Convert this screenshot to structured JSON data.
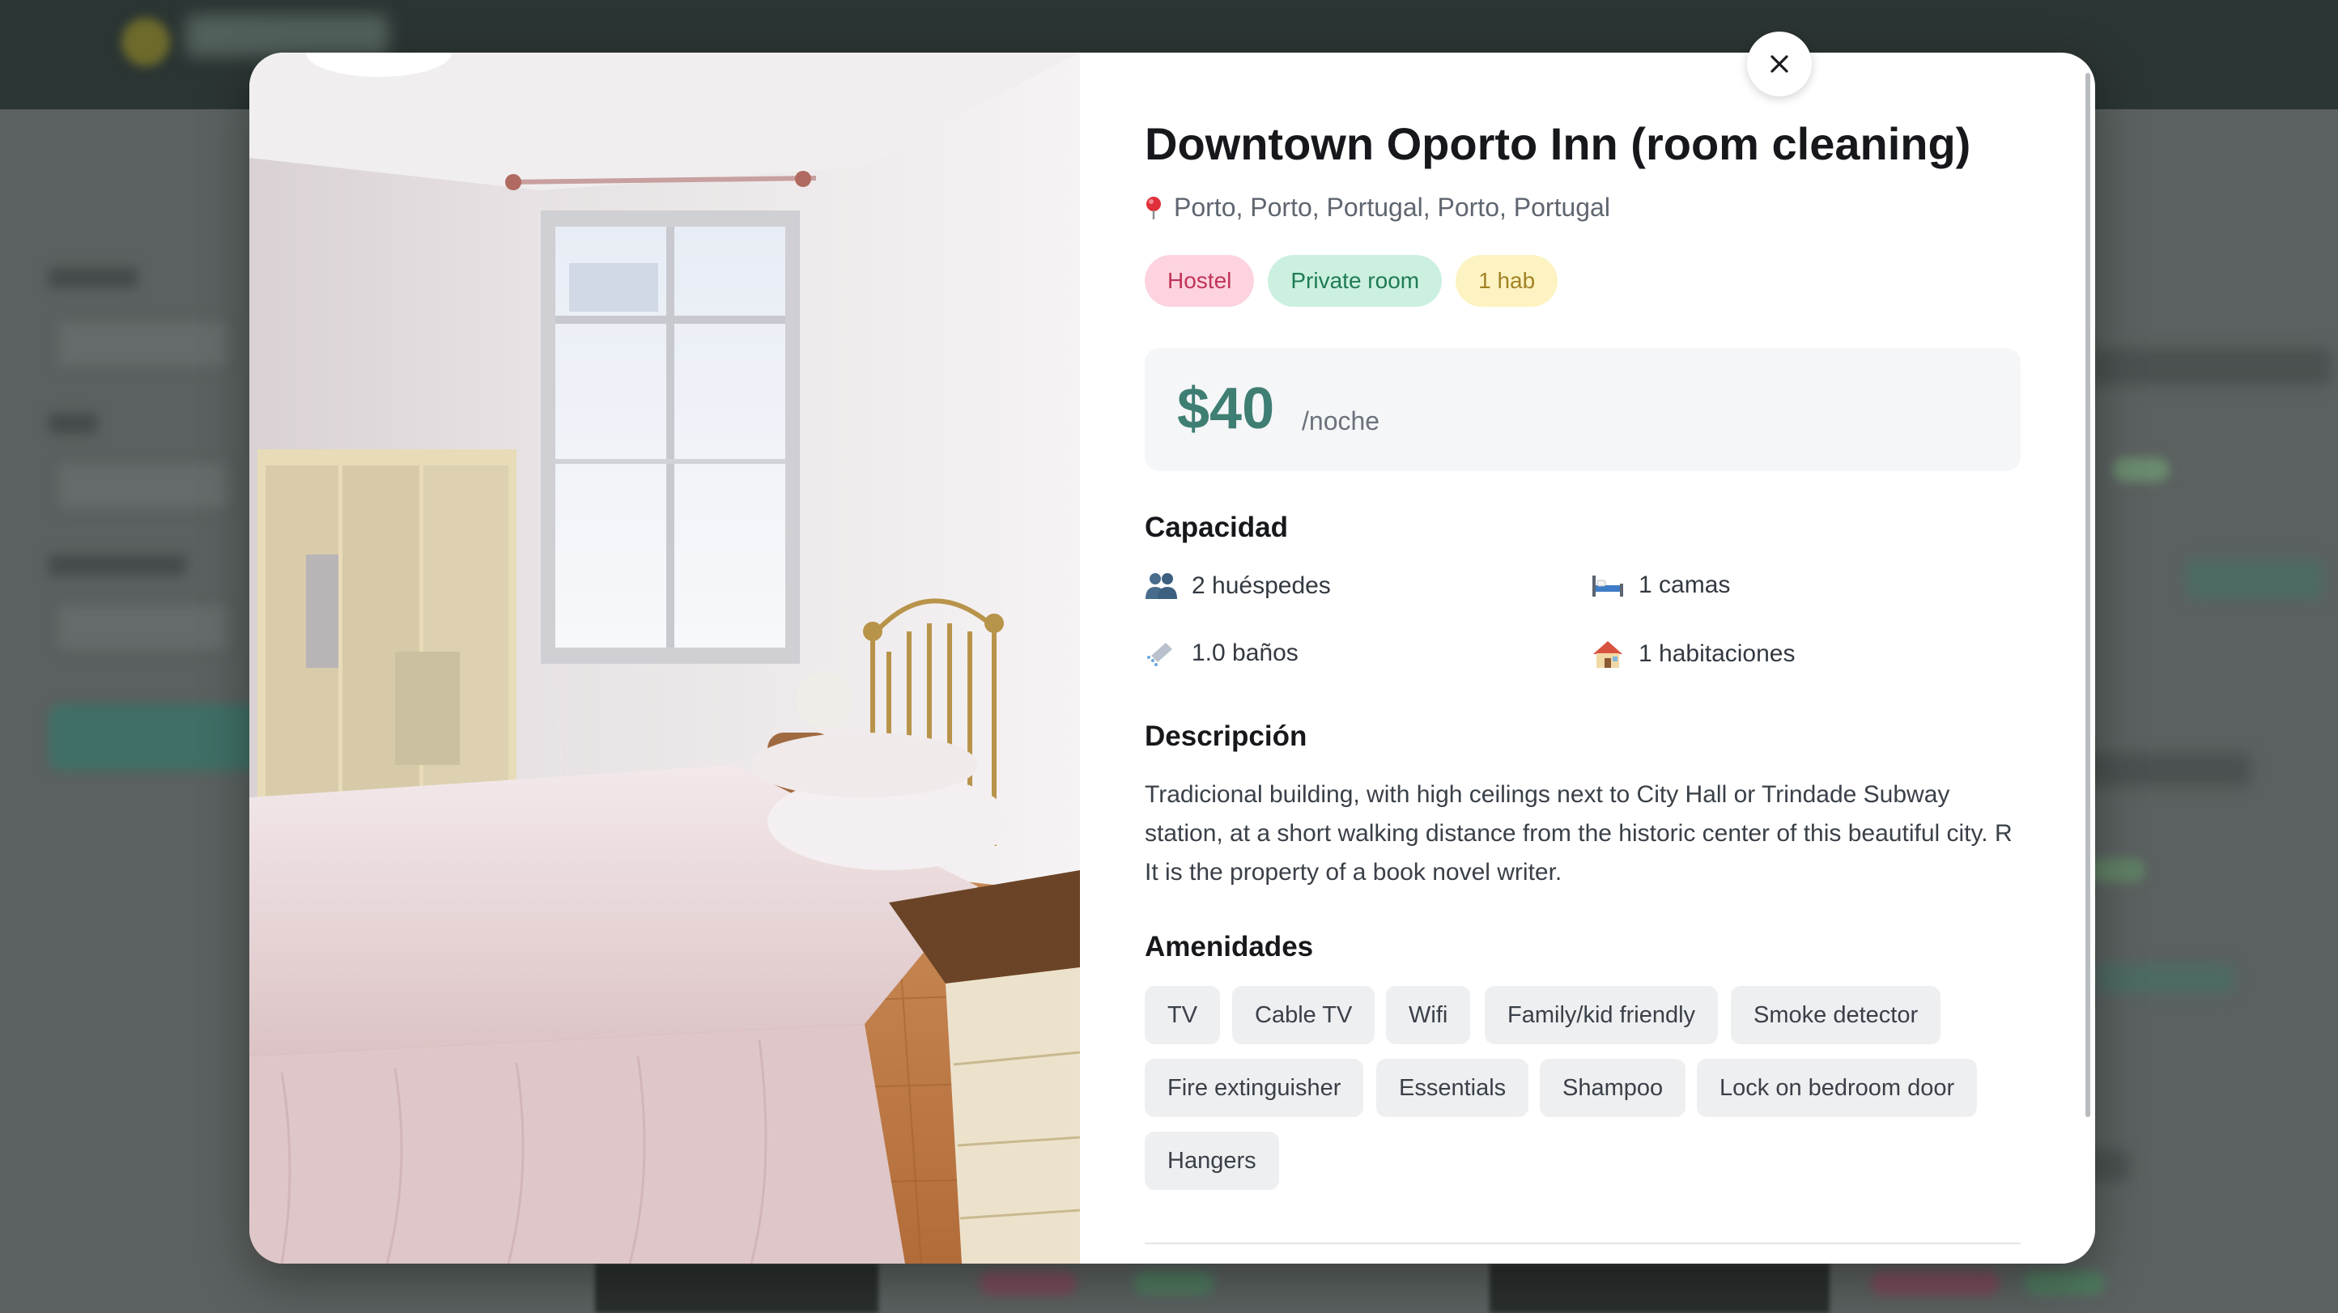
{
  "modal": {
    "title": "Downtown Oporto Inn (room cleaning)",
    "location": "Porto, Porto, Portugal, Porto, Portugal",
    "badges": [
      "Hostel",
      "Private room",
      "1 hab"
    ],
    "price": "$40",
    "price_unit": "/noche",
    "capacity_heading": "Capacidad",
    "capacity": {
      "guests": "2 huéspedes",
      "beds": "1 camas",
      "baths": "1.0 baños",
      "rooms": "1 habitaciones"
    },
    "description_heading": "Descripción",
    "description": "Tradicional building, with high ceilings next to City Hall or Trindade Subway station, at a short walking distance from the historic center of this beautiful city. R It is the property of a book novel writer.",
    "amenities_heading": "Amenidades",
    "amenities": [
      "TV",
      "Cable TV",
      "Wifi",
      "Family/kid friendly",
      "Smoke detector",
      "Fire extinguisher",
      "Essentials",
      "Shampoo",
      "Lock on bedroom door",
      "Hangers"
    ]
  },
  "icons": {
    "close": "close-icon",
    "location": "map-pin-icon",
    "guests": "people-icon",
    "beds": "bed-icon",
    "baths": "shower-icon",
    "rooms": "house-icon"
  },
  "colors": {
    "accent_price": "#3f7e73",
    "badge_hostel": "#c23359",
    "badge_private_room": "#1f7a55",
    "badge_hab": "#a28224",
    "overlay": "#5f6463"
  }
}
